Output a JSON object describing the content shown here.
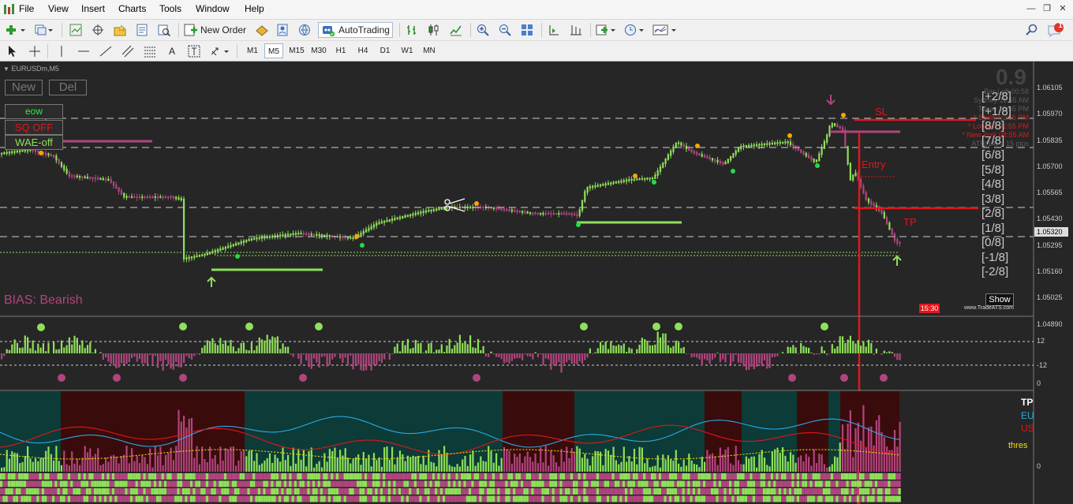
{
  "menu": {
    "items": [
      "File",
      "View",
      "Insert",
      "Charts",
      "Tools",
      "Window",
      "Help"
    ]
  },
  "toolbar": {
    "new_order": "New Order",
    "autotrading": "AutoTrading"
  },
  "timeframes": [
    "M1",
    "M5",
    "M15",
    "M30",
    "H1",
    "H4",
    "D1",
    "W1",
    "MN"
  ],
  "active_timeframe": "M5",
  "notification_count": "1",
  "chart": {
    "symbol": "EURUSDm,M5",
    "new_button": "New",
    "del_button": "Del",
    "panel_buttons": [
      "eow",
      "SQ OFF",
      "WAE-off"
    ],
    "bias": "BIAS: Bearish",
    "spread": "0.9",
    "info_lines": [
      "Bar Left 00:58",
      "Sydney 11:55 AM",
      "Tokyo 10:55 PM"
    ],
    "session_lines": [
      "* Berlin  02:55 PM",
      "* London  01:55 PM",
      "* New York  08:55 AM"
    ],
    "atr_line": "ATR(14) = 15 pips",
    "murrey_levels": [
      "[+2/8]",
      "[+1/8]",
      "[8/8]",
      "[7/8]",
      "[6/8]",
      "[5/8]",
      "[4/8]",
      "[3/8]",
      "[2/8]",
      "[1/8]",
      "[0/8]",
      "[-1/8]",
      "[-2/8]"
    ],
    "trade_labels": {
      "sl": "SL",
      "entry": "Entry",
      "tp": "TP"
    },
    "show_button": "Show",
    "time_label": "15:30",
    "watermark": "www.TradeATS.com",
    "price_axis": [
      "1.06105",
      "1.05970",
      "1.05835",
      "1.05700",
      "1.05565",
      "1.05430",
      "1.05295",
      "1.05160",
      "1.05025",
      "1.04890"
    ],
    "current_price": "1.05320",
    "osc_axis": [
      "12",
      "-12",
      "0"
    ],
    "bottom_axis": [
      "0"
    ],
    "bottom_legend": [
      "TP",
      "EU",
      "US",
      "thres"
    ]
  },
  "colors": {
    "chart_bg": "#262626",
    "bull": "#8fe05a",
    "bear": "#b0457e",
    "level_red": "#e0161c",
    "murrey_text": "#c8c8c8"
  }
}
